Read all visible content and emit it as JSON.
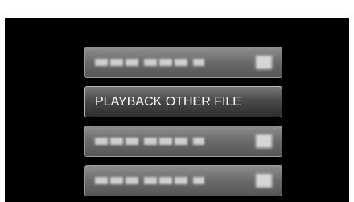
{
  "menu": {
    "items": [
      {
        "label": "",
        "state": "disabled"
      },
      {
        "label": "PLAYBACK OTHER FILE",
        "state": "selected"
      },
      {
        "label": "",
        "state": "disabled"
      },
      {
        "label": "",
        "state": "disabled"
      }
    ]
  },
  "colors": {
    "screen_background": "#000000",
    "button_text": "#ffffff",
    "button_face": "#6a6a6a"
  }
}
